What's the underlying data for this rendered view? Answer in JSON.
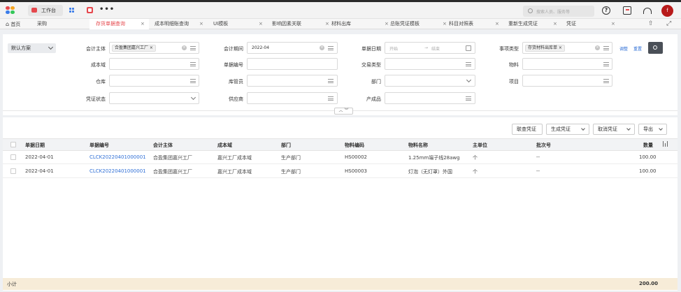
{
  "header": {
    "workbench_label": "工作台",
    "more_label": "•••",
    "search_placeholder": "搜索人员、服务等",
    "avatar_letter": "f",
    "help_glyph": "?"
  },
  "tabs": {
    "home": "首页",
    "items": [
      {
        "label": "采购"
      },
      {
        "label": "存货单据查询"
      },
      {
        "label": "成本明细账查询"
      },
      {
        "label": "UI模板"
      },
      {
        "label": "影响因素关联"
      },
      {
        "label": "材料出库"
      },
      {
        "label": "总账凭证模板"
      },
      {
        "label": "科目对照表"
      },
      {
        "label": "重新生成凭证"
      },
      {
        "label": "凭证"
      }
    ],
    "close_glyph": "×",
    "up_glyph": "⇧",
    "expand_glyph": "⤢"
  },
  "filter": {
    "scheme_label": "默认方案",
    "fields": {
      "accounting_entity_label": "会计主体",
      "accounting_entity_tag": "合盈集团嘉兴工厂",
      "period_label": "会计期间",
      "period_value": "2022-04",
      "doc_date_label": "单据日期",
      "doc_date_start": "开始",
      "doc_date_sep": "→",
      "doc_date_end": "结束",
      "item_type_label": "事项类型",
      "item_type_tag": "存货材料出库单",
      "cost_domain_label": "成本域",
      "doc_no_label": "单据编号",
      "trade_type_label": "交易类型",
      "material_label": "物料",
      "warehouse_label": "仓库",
      "keeper_label": "库管员",
      "dept_label": "部门",
      "project_label": "项目",
      "voucher_status_label": "凭证状态",
      "supplier_label": "供应商",
      "product_label": "产成品"
    },
    "adjust_link": "调整",
    "reset_link": "重置",
    "collapse_glyph": "︿ ︾"
  },
  "toolbar": {
    "link_voucher": "联查凭证",
    "gen_voucher": "生成凭证",
    "cancel_voucher": "取消凭证",
    "export": "导出"
  },
  "table": {
    "columns": [
      "单据日期",
      "单据编号",
      "会计主体",
      "成本域",
      "部门",
      "物料编码",
      "物料名称",
      "主单位",
      "批次号",
      "数量"
    ],
    "rows": [
      [
        "2022-04-01",
        "CLCK20220401000001",
        "合盈集团嘉兴工厂",
        "嘉兴工厂成本域",
        "生产部门",
        "HS00002",
        "1.25mm端子线28awg",
        "个",
        "--",
        "100.00"
      ],
      [
        "2022-04-01",
        "CLCK20220401000001",
        "合盈集团嘉兴工厂",
        "嘉兴工厂成本域",
        "生产部门",
        "HS00003",
        "灯泡（无灯罩）外国",
        "个",
        "--",
        "100.00"
      ]
    ],
    "subtotal_label": "小计",
    "subtotal_value": "200.00"
  },
  "colors": {
    "accent": "#e5484d",
    "link": "#2f6fd6",
    "subtotal_bg": "#f7ecd8"
  }
}
